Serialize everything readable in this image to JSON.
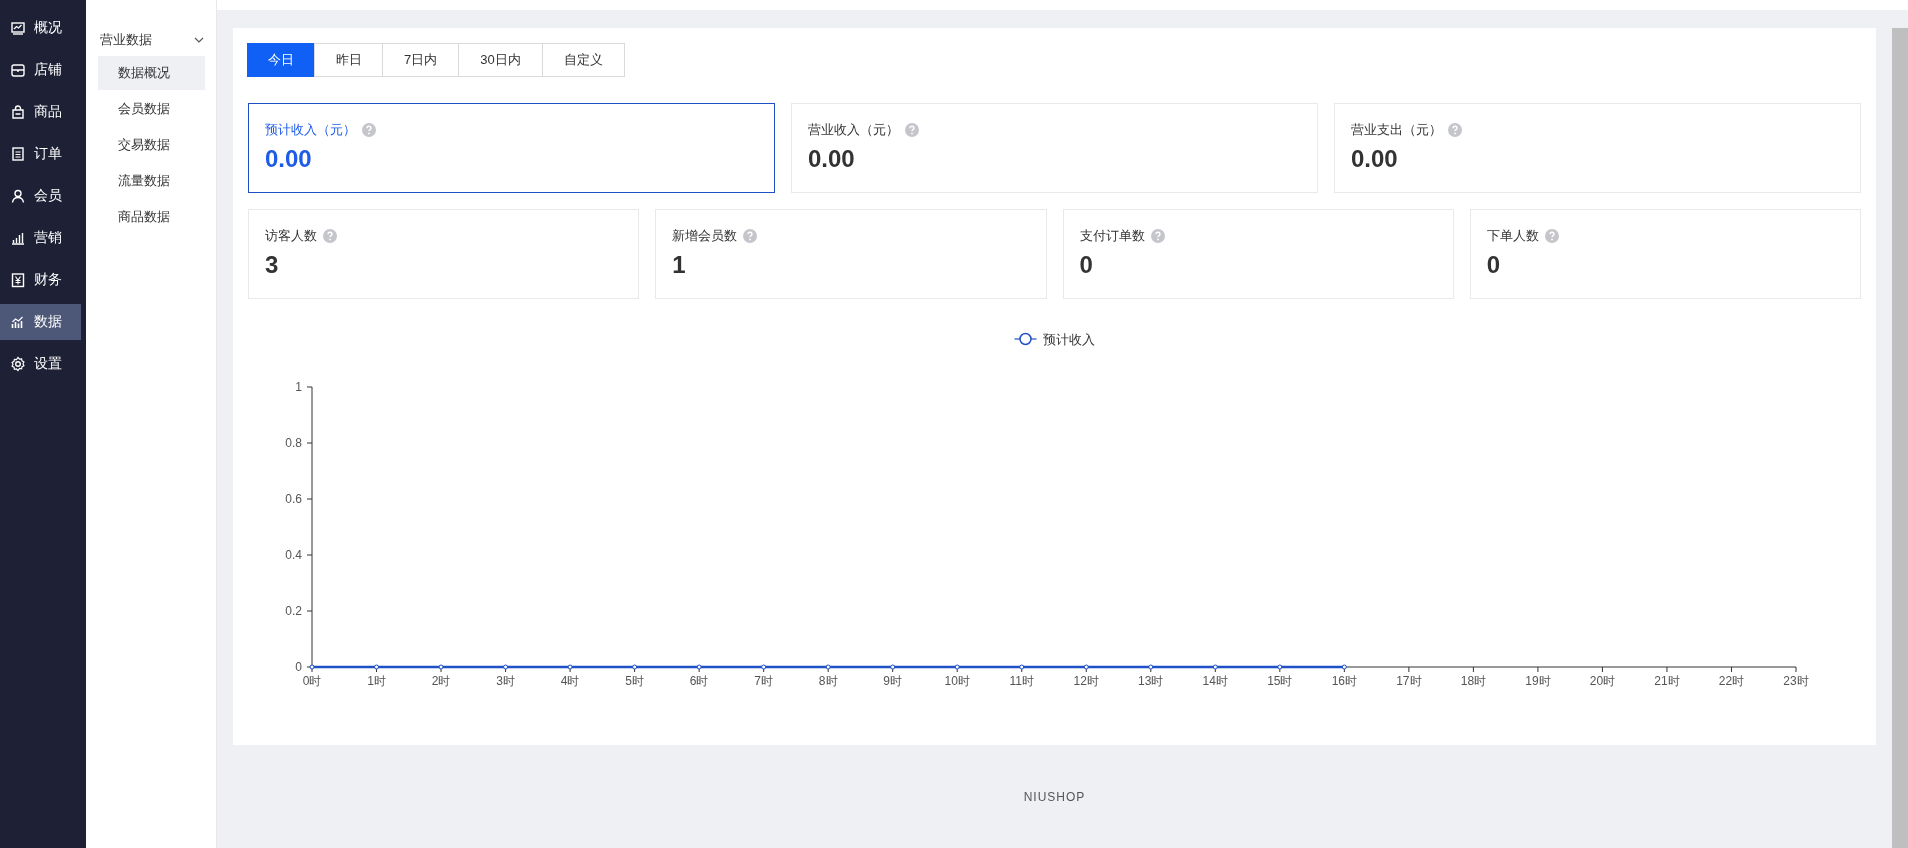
{
  "sidebar": {
    "items": [
      {
        "label": "概况",
        "selected": false
      },
      {
        "label": "店铺",
        "selected": false
      },
      {
        "label": "商品",
        "selected": false
      },
      {
        "label": "订单",
        "selected": false
      },
      {
        "label": "会员",
        "selected": false
      },
      {
        "label": "营销",
        "selected": false
      },
      {
        "label": "财务",
        "selected": false
      },
      {
        "label": "数据",
        "selected": true
      },
      {
        "label": "设置",
        "selected": false
      }
    ]
  },
  "subnav": {
    "groups": [
      {
        "label": "营业数据",
        "expanded": true,
        "children": [
          {
            "label": "数据概况",
            "selected": true
          },
          {
            "label": "会员数据",
            "selected": false
          },
          {
            "label": "交易数据",
            "selected": false
          },
          {
            "label": "流量数据",
            "selected": false
          },
          {
            "label": "商品数据",
            "selected": false
          }
        ]
      }
    ]
  },
  "date_tabs": [
    {
      "label": "今日",
      "selected": true
    },
    {
      "label": "昨日",
      "selected": false
    },
    {
      "label": "7日内",
      "selected": false
    },
    {
      "label": "30日内",
      "selected": false
    },
    {
      "label": "自定义",
      "selected": false
    }
  ],
  "money_cards": [
    {
      "label": "预计收入（元）",
      "value": "0.00",
      "selected": true
    },
    {
      "label": "营业收入（元）",
      "value": "0.00",
      "selected": false
    },
    {
      "label": "营业支出（元）",
      "value": "0.00",
      "selected": false
    }
  ],
  "count_cards": [
    {
      "label": "访客人数",
      "value": "3",
      "selected": false
    },
    {
      "label": "新增会员数",
      "value": "1",
      "selected": false
    },
    {
      "label": "支付订单数",
      "value": "0",
      "selected": false
    },
    {
      "label": "下单人数",
      "value": "0",
      "selected": false
    }
  ],
  "chart": {
    "chart_data": {
      "type": "line",
      "categories": [
        "0时",
        "1时",
        "2时",
        "3时",
        "4时",
        "5时",
        "6时",
        "7时",
        "8时",
        "9时",
        "10时",
        "11时",
        "12时",
        "13时",
        "14时",
        "15时",
        "16时",
        "17时",
        "18时",
        "19时",
        "20时",
        "21时",
        "22时",
        "23时"
      ],
      "series": [
        {
          "name": "预计收入",
          "color": "#1e50c8",
          "marker": true,
          "values": [
            0,
            0,
            0,
            0,
            0,
            0,
            0,
            0,
            0,
            0,
            0,
            0,
            0,
            0,
            0,
            0,
            0,
            null,
            null,
            null,
            null,
            null,
            null,
            null
          ]
        }
      ],
      "ylim": [
        0,
        1
      ],
      "yticks": [
        0,
        0.2,
        0.4,
        0.6,
        0.8,
        1
      ]
    }
  },
  "footer": "NIUSHOP"
}
